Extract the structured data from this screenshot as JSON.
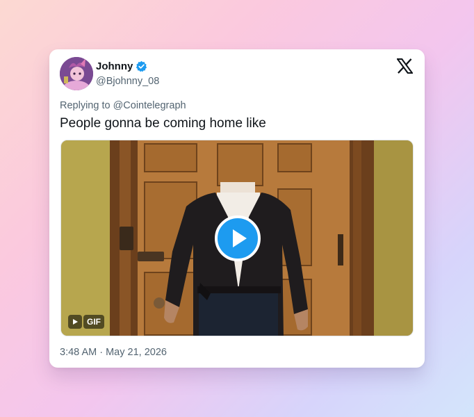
{
  "tweet": {
    "display_name": "Johnny",
    "handle": "@Bjohnny_08",
    "replying_to": "Replying to @Cointelegraph",
    "text": "People gonna be coming home like",
    "media_badge": "GIF",
    "timestamp": "3:48 AM · May 21, 2026"
  },
  "colors": {
    "accent": "#1d9bf0",
    "text_primary": "#0f1419",
    "text_secondary": "#536471"
  },
  "icons": {
    "verified": "verified-badge-icon",
    "brand": "x-logo-icon",
    "play": "play-icon"
  }
}
